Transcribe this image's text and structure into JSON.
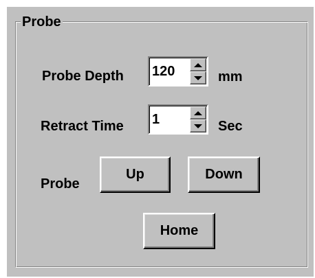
{
  "probe_group": {
    "title": "Probe"
  },
  "probe_depth": {
    "label": "Probe Depth",
    "value": "120",
    "unit": "mm"
  },
  "retract_time": {
    "label": "Retract Time",
    "value": "1",
    "unit": "Sec"
  },
  "probe_controls": {
    "label": "Probe",
    "up_label": "Up",
    "down_label": "Down",
    "home_label": "Home"
  },
  "icons": {
    "spin_up": "arrow-up-icon",
    "spin_down": "arrow-down-icon"
  },
  "colors": {
    "face": "#c0c0c0",
    "highlight": "#ffffff",
    "shadow": "#808080",
    "dark_shadow": "#000000"
  }
}
